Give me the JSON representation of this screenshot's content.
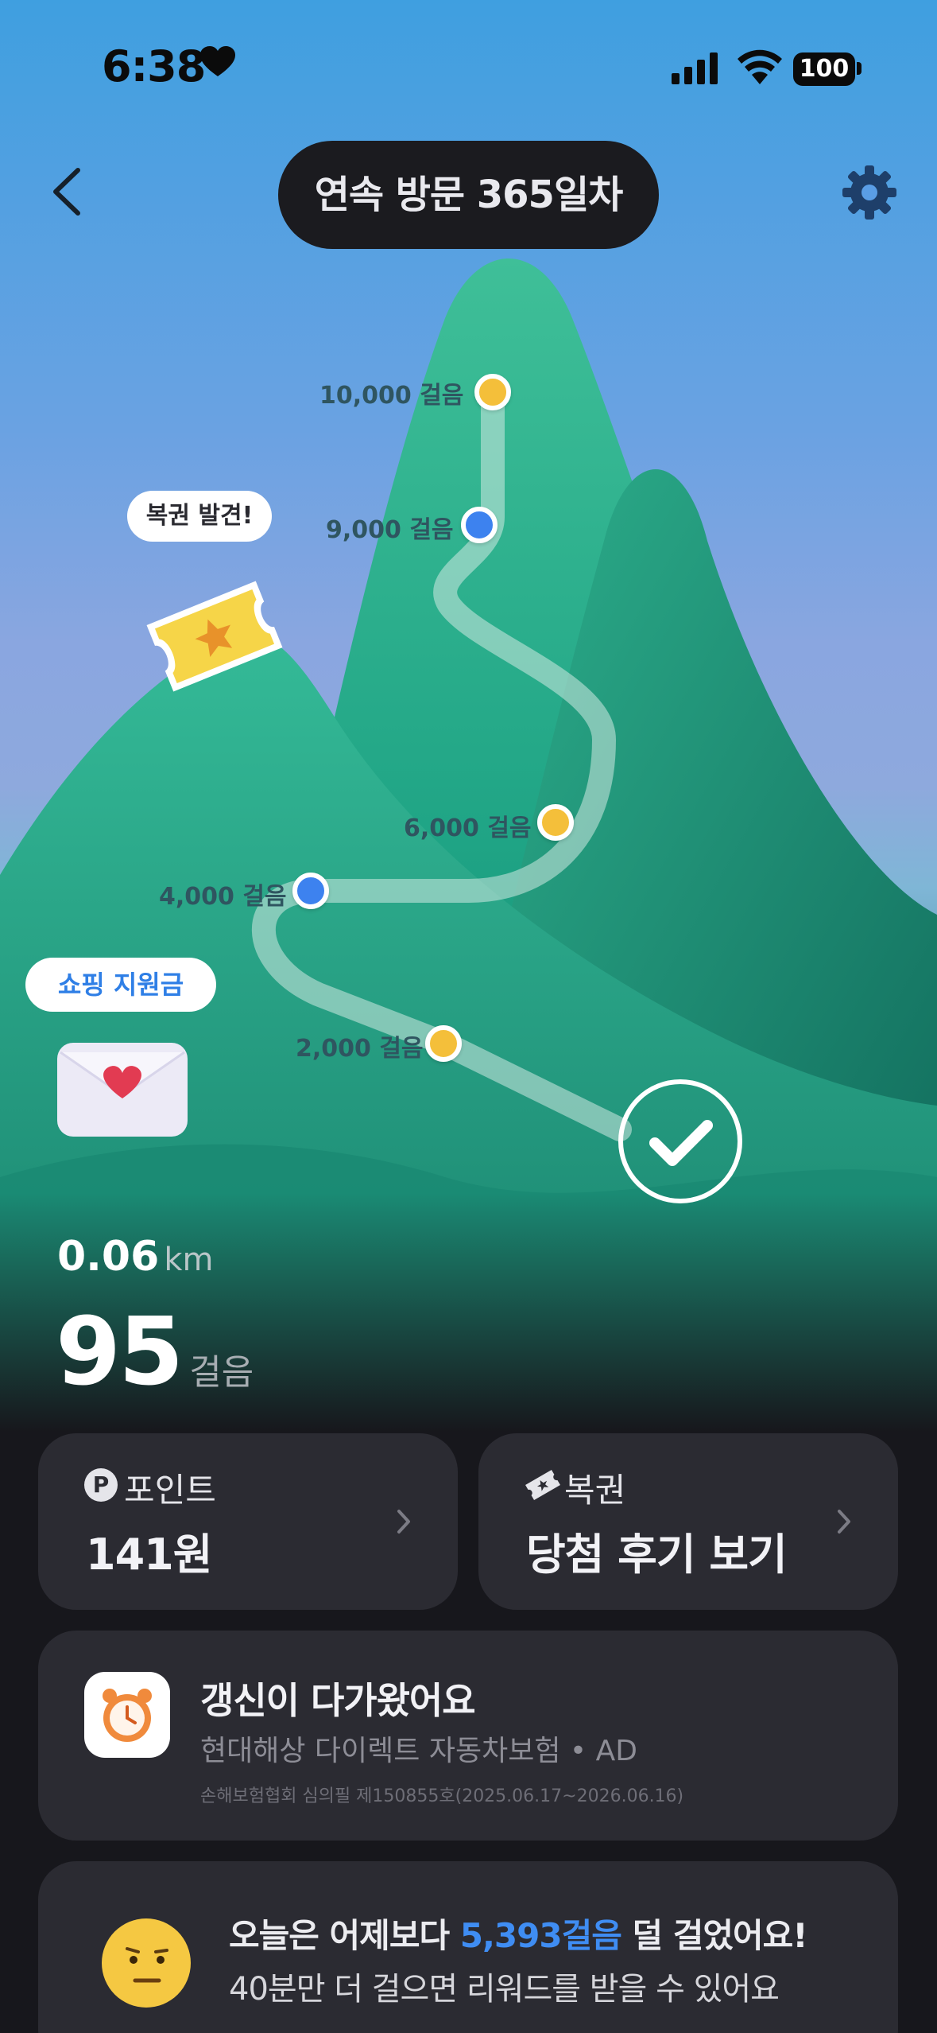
{
  "status_bar": {
    "time": "6:38",
    "battery": "100"
  },
  "header": {
    "title": "연속 방문 365일차"
  },
  "milestones": [
    {
      "label": "10,000 걸음",
      "color": "yellow"
    },
    {
      "label": "9,000 걸음",
      "color": "blue"
    },
    {
      "label": "6,000 걸음",
      "color": "yellow"
    },
    {
      "label": "4,000 걸음",
      "color": "blue"
    },
    {
      "label": "2,000 걸음",
      "color": "yellow"
    }
  ],
  "bubbles": {
    "lottery_found": "복권 발견!",
    "shopping_support": "쇼핑 지원금"
  },
  "stats": {
    "distance": "0.06",
    "distance_unit": "km",
    "steps": "95",
    "steps_unit": "걸음"
  },
  "cards": {
    "point": {
      "label": "포인트",
      "value": "141원",
      "icon": "P"
    },
    "lottery": {
      "label": "복권",
      "value": "당첨 후기 보기"
    }
  },
  "ad": {
    "title": "갱신이 다가왔어요",
    "subtitle": "현대해상 다이렉트 자동차보험 • AD",
    "note": "손해보험협회 심의필 제150855호(2025.06.17~2026.06.16)"
  },
  "comparison": {
    "prefix": "오늘은 어제보다 ",
    "highlight": "5,393걸음",
    "suffix": " 덜 걸었어요!",
    "line2": "40분만 더 걸으면 리워드를 받을 수 있어요"
  },
  "colors": {
    "accent": "#3f8df3",
    "dot_yellow": "#f4bf3a",
    "dot_blue": "#3d82ef",
    "card_bg": "#2b2b32"
  }
}
